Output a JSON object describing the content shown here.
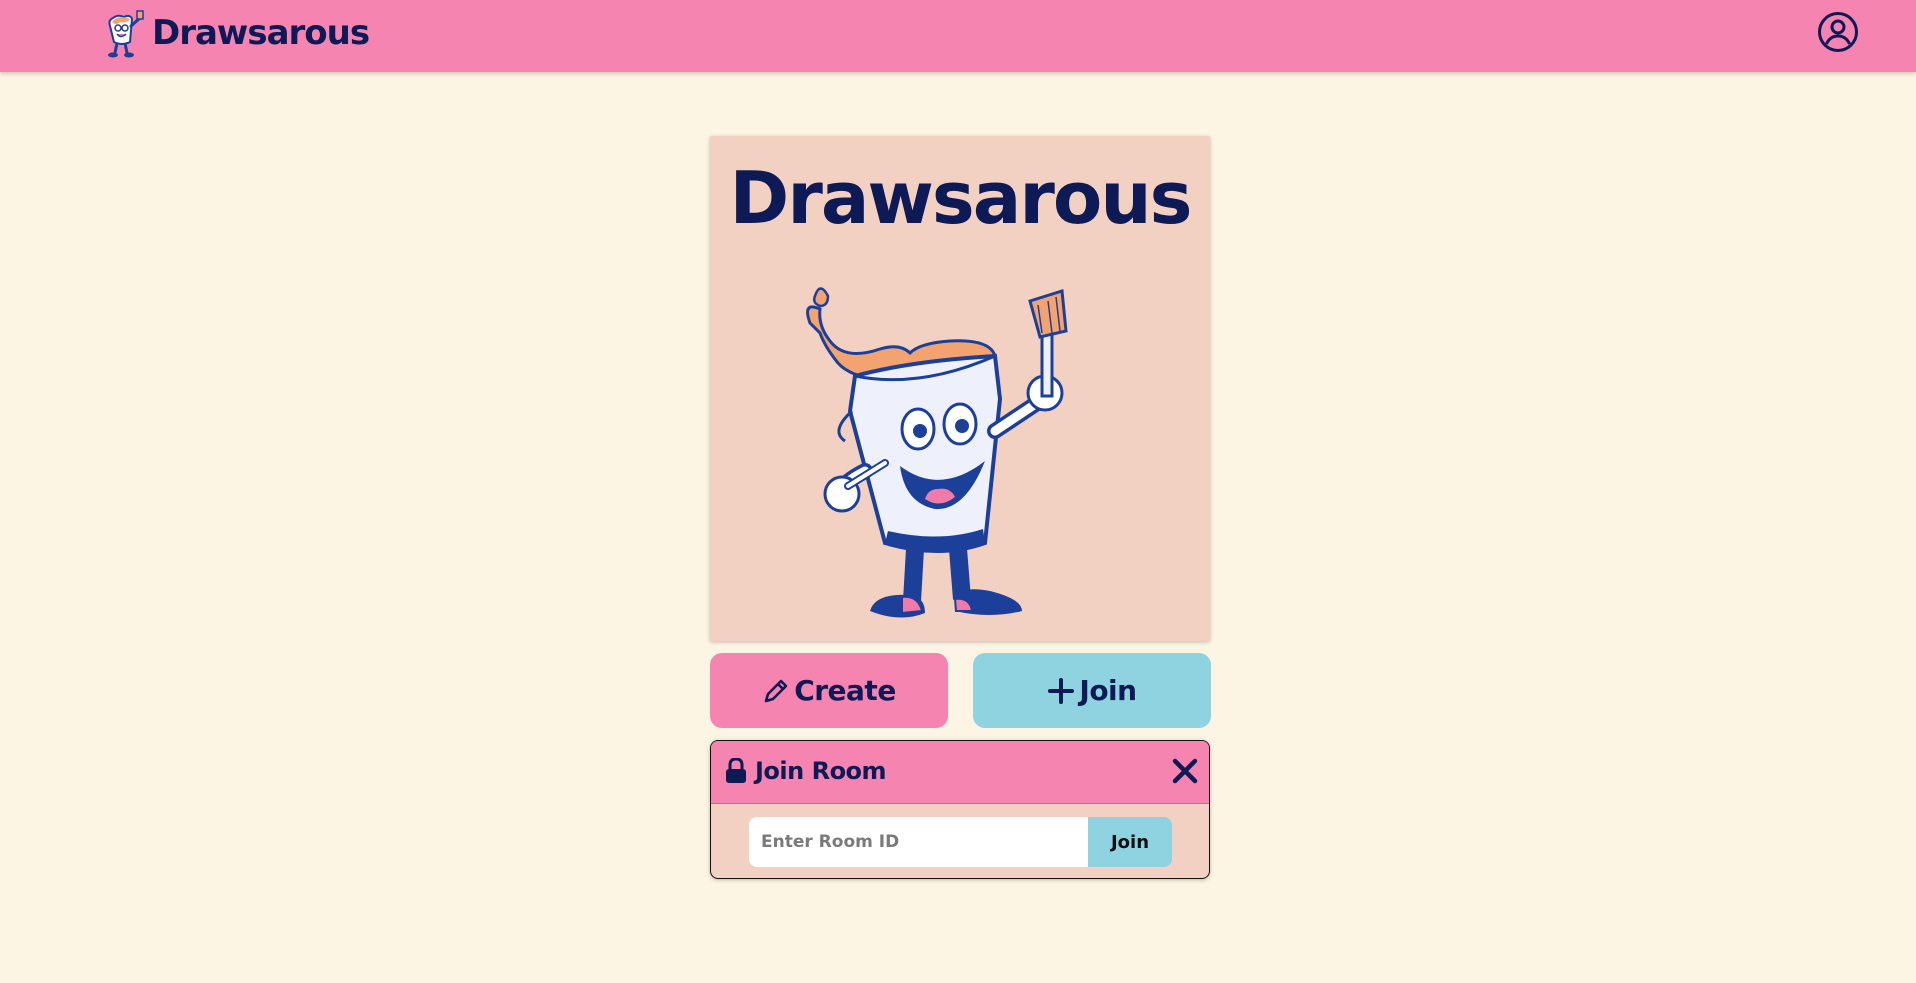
{
  "app": {
    "brand_name": "Drawsarous",
    "brand_logo_icon": "paint-bucket-mascot-icon",
    "profile_icon": "user-circle-icon"
  },
  "hero": {
    "title": "Drawsarous",
    "mascot": "paint-bucket-mascot-illustration"
  },
  "actions": {
    "create_label": "Create",
    "create_icon": "pencil-icon",
    "join_label": "Join",
    "join_icon": "plus-icon"
  },
  "join_room": {
    "title": "Join Room",
    "title_icon": "lock-icon",
    "close_icon": "close-icon",
    "input_placeholder": "Enter Room ID",
    "input_value": "",
    "join_button_label": "Join"
  },
  "colors": {
    "background": "#fdf5e4",
    "navbar": "#f584b0",
    "card": "#f2d1c3",
    "create_button": "#f584b0",
    "join_button": "#8ed3df",
    "text": "#0e1a55"
  }
}
